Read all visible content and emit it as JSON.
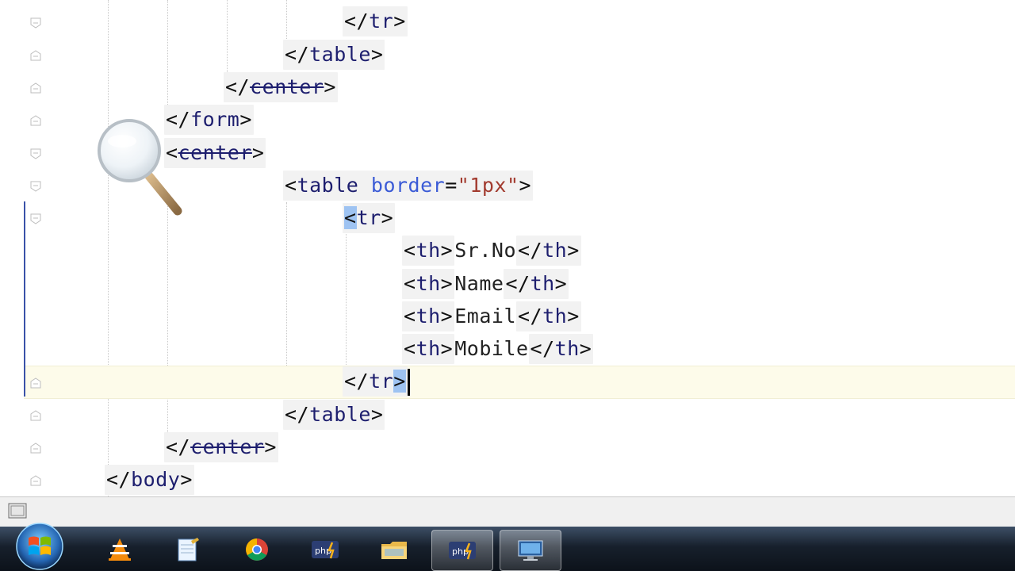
{
  "editor": {
    "lines": [
      {
        "close_tag": "tr"
      },
      {
        "close_tag": "table"
      },
      {
        "close_tag": "center"
      },
      {
        "close_tag": "form"
      },
      {
        "open_tag": "center"
      },
      {
        "open_tag": "table",
        "attr_name": "border",
        "attr_value": "\"1px\""
      },
      {
        "open_tag": "tr"
      },
      {
        "open_tag": "th",
        "text": "Sr.No",
        "close_tag": "th"
      },
      {
        "open_tag": "th",
        "text": "Name",
        "close_tag": "th"
      },
      {
        "open_tag": "th",
        "text": "Email",
        "close_tag": "th"
      },
      {
        "open_tag": "th",
        "text": "Mobile",
        "close_tag": "th"
      },
      {
        "close_tag": "tr"
      },
      {
        "close_tag": "table"
      },
      {
        "close_tag": "center"
      },
      {
        "close_tag": "body"
      }
    ]
  },
  "taskbar": {
    "items": [
      {
        "name": "windows-start-orb",
        "active": false
      },
      {
        "name": "vlc-icon",
        "active": false
      },
      {
        "name": "notepad-icon",
        "active": false
      },
      {
        "name": "chrome-icon",
        "active": false
      },
      {
        "name": "phpstorm-icon",
        "active": false
      },
      {
        "name": "explorer-folder-icon",
        "active": false
      },
      {
        "name": "phpstorm-icon",
        "active": true
      },
      {
        "name": "remote-desktop-icon",
        "active": false
      }
    ],
    "accent": "#3b5bd6"
  }
}
